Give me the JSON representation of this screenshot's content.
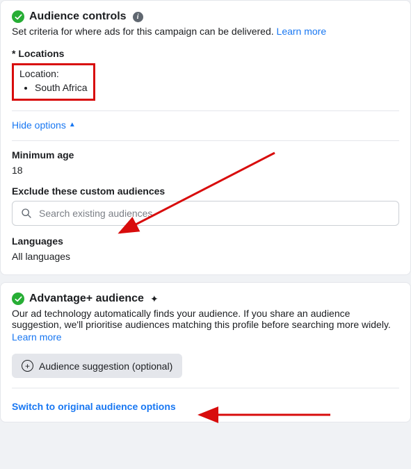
{
  "audience_controls": {
    "title": "Audience controls",
    "subtext": "Set criteria for where ads for this campaign can be delivered. ",
    "learn_more": "Learn more",
    "locations_label": "* Locations",
    "location_title": "Location:",
    "location_item": "South Africa",
    "hide_options": "Hide options",
    "min_age_label": "Minimum age",
    "min_age_value": "18",
    "exclude_label": "Exclude these custom audiences",
    "search_placeholder": "Search existing audiences",
    "languages_label": "Languages",
    "languages_value": "All languages"
  },
  "advantage": {
    "title": "Advantage+ audience",
    "desc": "Our ad technology automatically finds your audience. If you share an audience suggestion, we'll prioritise audiences matching this profile before searching more widely. ",
    "learn_more": "Learn more",
    "suggestion_btn": "Audience suggestion (optional)",
    "switch_link": "Switch to original audience options"
  }
}
